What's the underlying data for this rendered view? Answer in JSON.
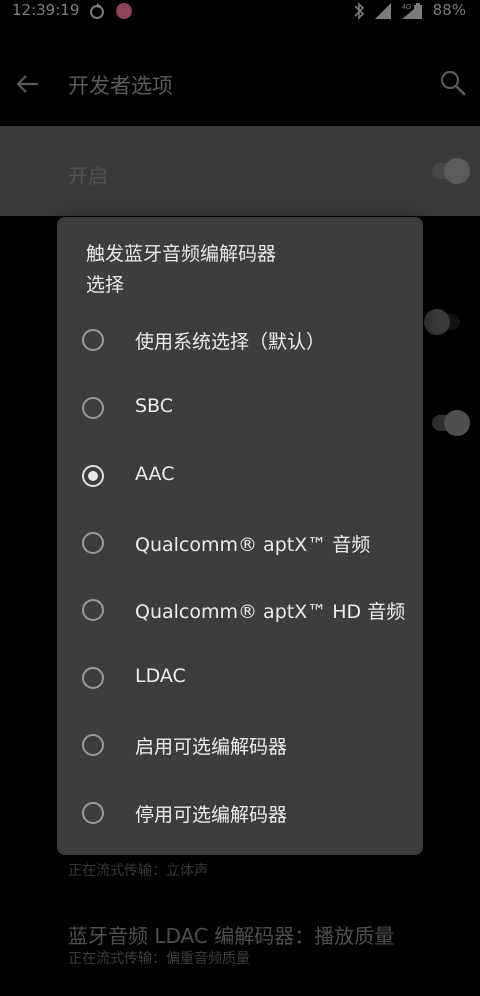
{
  "status_bar": {
    "time": "12:39:19",
    "battery": "88%",
    "network": "4G",
    "icons": [
      "sync-icon",
      "notification-badge-icon",
      "bluetooth-icon",
      "signal-icon",
      "data-signal-icon",
      "battery-icon"
    ]
  },
  "app_bar": {
    "title": "开发者选项",
    "back_icon": "arrow-back-icon",
    "search_icon": "search-icon"
  },
  "master_switch": {
    "label": "开启",
    "on": true
  },
  "background_items": {
    "streaming_stereo": "正在流式传输：立体声",
    "ldac_title": "蓝牙音频 LDAC 编解码器：播放质量",
    "ldac_sub": "正在流式传输：偏重音频质量"
  },
  "dialog": {
    "title_line1": "触发蓝牙音频编解码器",
    "title_line2": "选择",
    "selected_index": 2,
    "options": [
      "使用系统选择（默认）",
      "SBC",
      "AAC",
      "Qualcomm® aptX™ 音频",
      "Qualcomm® aptX™ HD 音频",
      "LDAC",
      "启用可选编解码器",
      "停用可选编解码器"
    ]
  },
  "colors": {
    "background": "#000000",
    "dialog": "#3d3d3d",
    "master_row": "#5a5a5a",
    "text_primary": "#ececec",
    "text_muted": "#787878"
  }
}
